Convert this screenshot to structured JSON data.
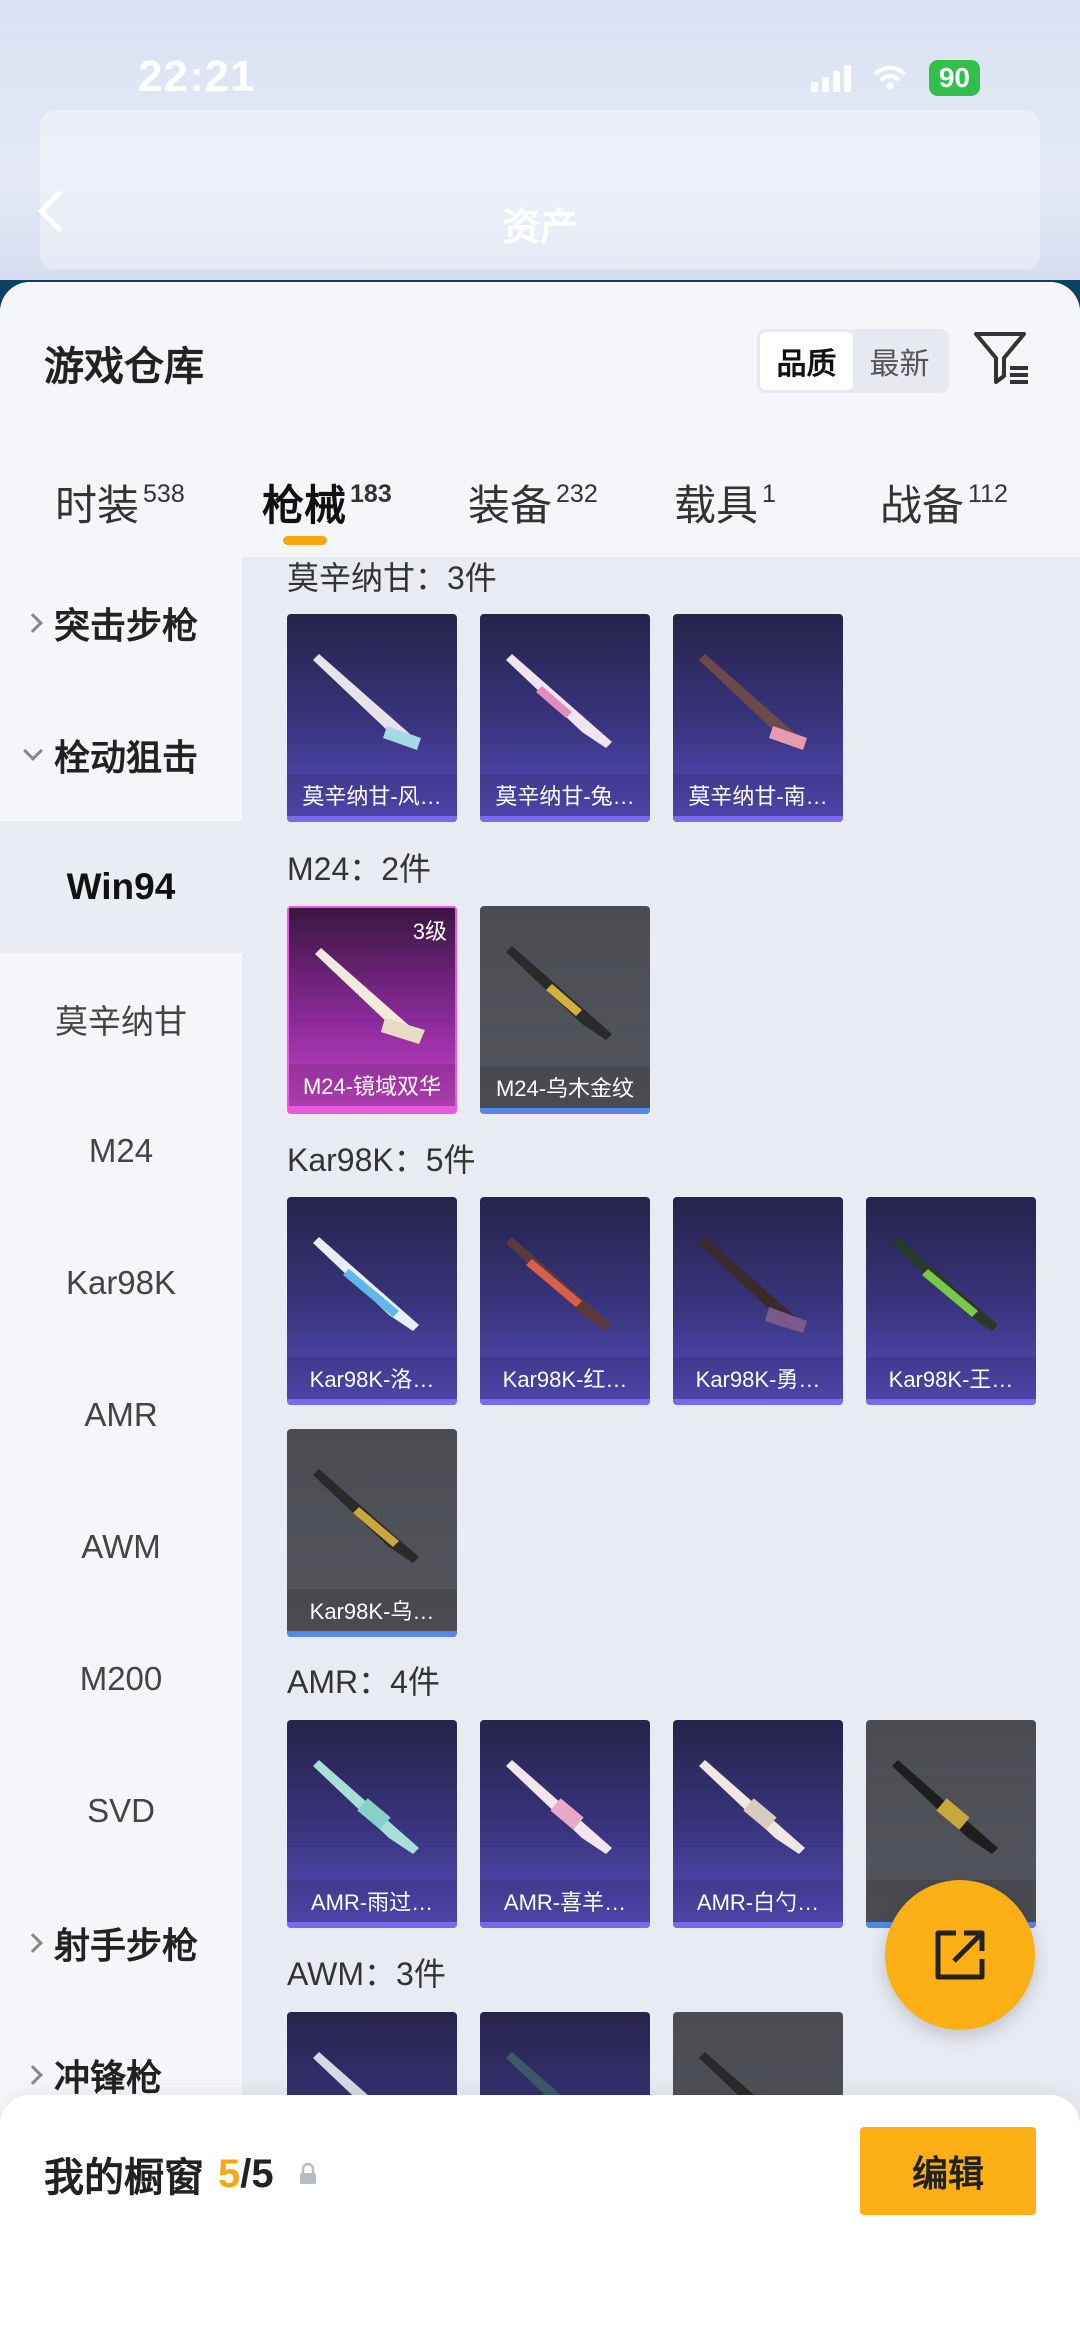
{
  "status": {
    "time": "22:21",
    "battery": "90"
  },
  "header": {
    "page_title": "资产"
  },
  "warehouse": {
    "title": "游戏仓库",
    "sort": {
      "quality": "品质",
      "latest": "最新"
    }
  },
  "tabs": [
    {
      "label": "时装",
      "count": "538"
    },
    {
      "label": "枪械",
      "count": "183"
    },
    {
      "label": "装备",
      "count": "232"
    },
    {
      "label": "载具",
      "count": "1"
    },
    {
      "label": "战备",
      "count": "112"
    }
  ],
  "sidebar": {
    "categories": {
      "assault": "突击步枪",
      "bolt": "栓动狙击",
      "marksman": "射手步枪",
      "smg": "冲锋枪"
    },
    "subs": [
      "Win94",
      "莫辛纳甘",
      "M24",
      "Kar98K",
      "AMR",
      "AWM",
      "M200",
      "SVD"
    ]
  },
  "groups": {
    "mosin": {
      "title": "莫辛纳甘：3件",
      "items": [
        "莫辛纳甘-风…",
        "莫辛纳甘-兔…",
        "莫辛纳甘-南…"
      ]
    },
    "m24": {
      "title": "M24：2件",
      "items": [
        "M24-镜域双华",
        "M24-乌木金纹"
      ],
      "level": "3级"
    },
    "kar": {
      "title": "Kar98K：5件",
      "items": [
        "Kar98K-洛…",
        "Kar98K-红…",
        "Kar98K-勇…",
        "Kar98K-王…",
        "Kar98K-乌…"
      ]
    },
    "amr": {
      "title": "AMR：4件",
      "items": [
        "AMR-雨过…",
        "AMR-喜羊…",
        "AMR-白勺…",
        "AMR-…"
      ]
    },
    "awm": {
      "title": "AWM：3件"
    }
  },
  "bottom": {
    "showcase_label": "我的橱窗",
    "showcase_count": "5",
    "showcase_total": "/5",
    "edit_label": "编辑"
  },
  "colors": {
    "accent": "#fcb016",
    "purple_card": "#3a3580",
    "gold_card": "#55575e",
    "pink_card": "#c948c9"
  }
}
